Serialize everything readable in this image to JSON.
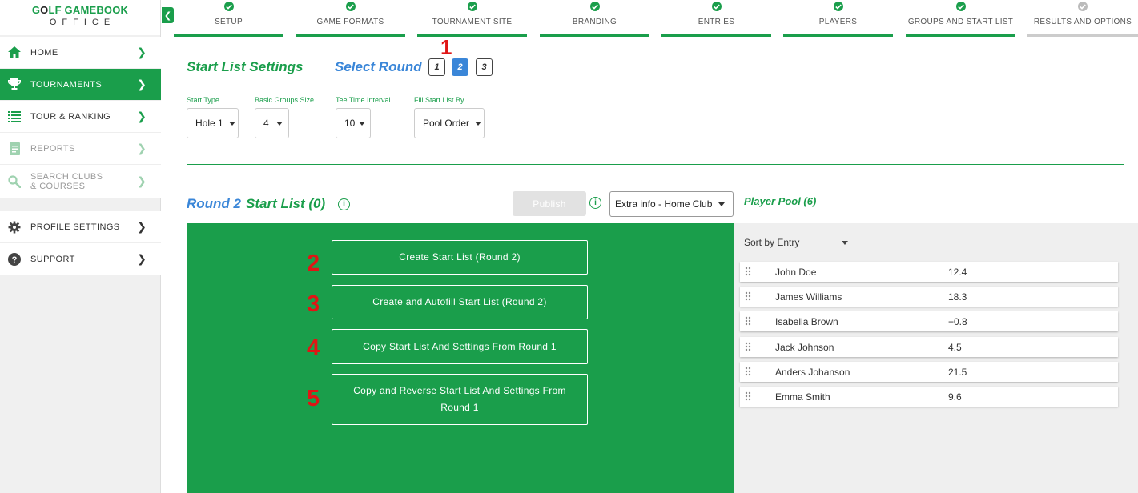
{
  "logo": {
    "top_a": "G",
    "top_o": "O",
    "top_b": "LF GAMEBOOK",
    "bottom": "OFFICE"
  },
  "sidebar": {
    "items": [
      {
        "label": "HOME",
        "icon": "home-icon"
      },
      {
        "label": "TOURNAMENTS",
        "icon": "trophy-icon"
      },
      {
        "label": "TOUR & RANKING",
        "icon": "list-icon"
      },
      {
        "label": "REPORTS",
        "icon": "document-icon"
      },
      {
        "label": "SEARCH CLUBS & COURSES",
        "icon": "search-icon"
      },
      {
        "label": "PROFILE SETTINGS",
        "icon": "gear-icon"
      },
      {
        "label": "SUPPORT",
        "icon": "help-icon"
      }
    ]
  },
  "steps": [
    {
      "label": "SETUP",
      "done": true
    },
    {
      "label": "GAME FORMATS",
      "done": true
    },
    {
      "label": "TOURNAMENT SITE",
      "done": true
    },
    {
      "label": "BRANDING",
      "done": true
    },
    {
      "label": "ENTRIES",
      "done": true
    },
    {
      "label": "PLAYERS",
      "done": true
    },
    {
      "label": "GROUPS AND START LIST",
      "done": true
    },
    {
      "label": "RESULTS AND OPTIONS",
      "done": false
    }
  ],
  "settings": {
    "title": "Start List Settings",
    "select_round": "Select Round",
    "rounds": [
      "1",
      "2",
      "3"
    ],
    "active_round": "2",
    "fields": [
      {
        "label": "Start Type",
        "value": "Hole 1"
      },
      {
        "label": "Basic Groups Size",
        "value": "4"
      },
      {
        "label": "Tee Time Interval",
        "value": "10"
      },
      {
        "label": "Fill Start List By",
        "value": "Pool Order"
      }
    ]
  },
  "annotations": {
    "n1": "1",
    "n2": "2",
    "n3": "3",
    "n4": "4",
    "n5": "5"
  },
  "start_list": {
    "round_label": "Round 2",
    "title": "Start List (0)",
    "publish": "Publish",
    "extra_info": "Extra info - Home Club",
    "actions": [
      "Create Start List (Round 2)",
      "Create and Autofill Start List (Round 2)",
      "Copy Start List And Settings From Round 1",
      "Copy and Reverse Start List And Settings From Round 1"
    ]
  },
  "pool": {
    "title": "Player Pool (6)",
    "sort": "Sort by Entry",
    "players": [
      {
        "name": "John Doe",
        "hcp": "12.4"
      },
      {
        "name": "James Williams",
        "hcp": "18.3"
      },
      {
        "name": "Isabella Brown",
        "hcp": "+0.8"
      },
      {
        "name": "Jack Johnson",
        "hcp": "4.5"
      },
      {
        "name": "Anders Johanson",
        "hcp": "21.5"
      },
      {
        "name": "Emma Smith",
        "hcp": "9.6"
      }
    ]
  },
  "colors": {
    "green": "#1a9e4b",
    "blue": "#3a86d8",
    "red": "#e01515"
  }
}
